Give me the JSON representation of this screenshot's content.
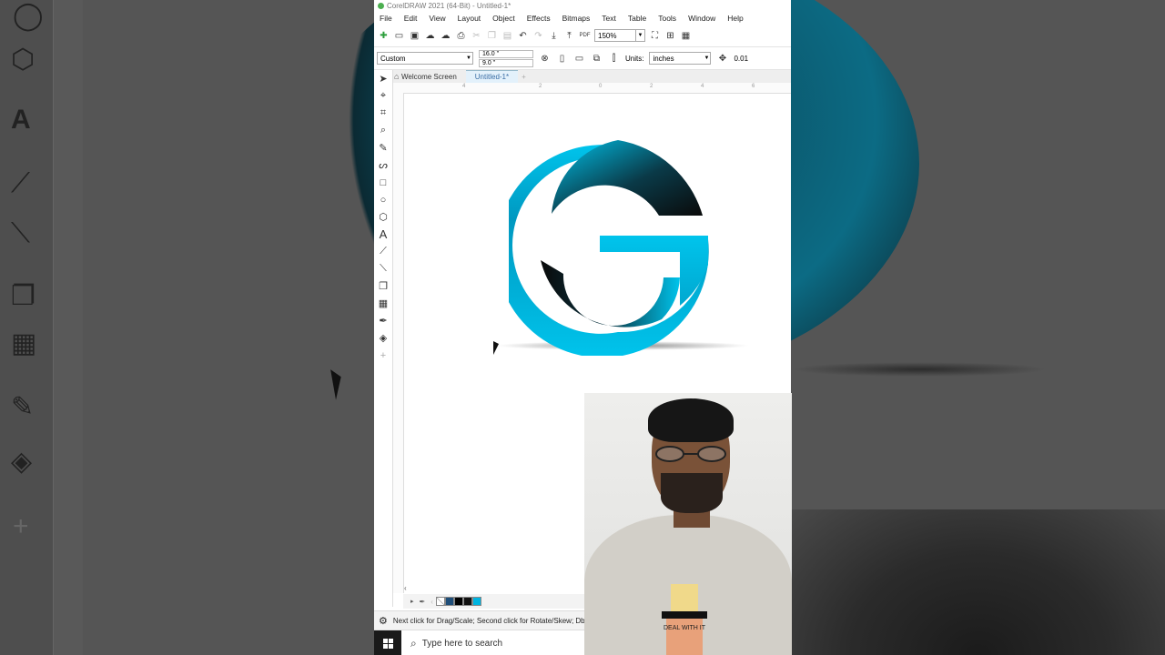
{
  "window": {
    "title": "CorelDRAW 2021 (64-Bit) - Untitled-1*"
  },
  "menu": [
    "File",
    "Edit",
    "View",
    "Layout",
    "Object",
    "Effects",
    "Bitmaps",
    "Text",
    "Table",
    "Tools",
    "Window",
    "Help"
  ],
  "toolbar": {
    "zoom": "150%",
    "pdf_label": "PDF"
  },
  "propbar": {
    "page_size": "Custom",
    "width": "16.0 \"",
    "height": "9.0 \"",
    "units_label": "Units:",
    "units_value": "inches",
    "nudge": "0.01"
  },
  "tabs": [
    {
      "label": "Welcome Screen"
    },
    {
      "label": "Untitled-1*"
    }
  ],
  "ruler": {
    "top_ticks": [
      "4",
      "2",
      "0",
      "2",
      "4",
      "6"
    ]
  },
  "palette": {
    "colors": [
      "#ffffff",
      "#1f4e79",
      "#000000",
      "#111111",
      "#00b4e0"
    ]
  },
  "status": {
    "hint": "Next click for Drag/Scale; Second click for Rotate/Skew; Dbl"
  },
  "taskbar": {
    "search_placeholder": "Type here to search"
  },
  "logo": {
    "letter": "G",
    "colors": {
      "cyan": "#00c4ec",
      "dark": "#0a0a0a"
    }
  },
  "webcam": {
    "shirt_text": "DEAL WITH IT"
  }
}
